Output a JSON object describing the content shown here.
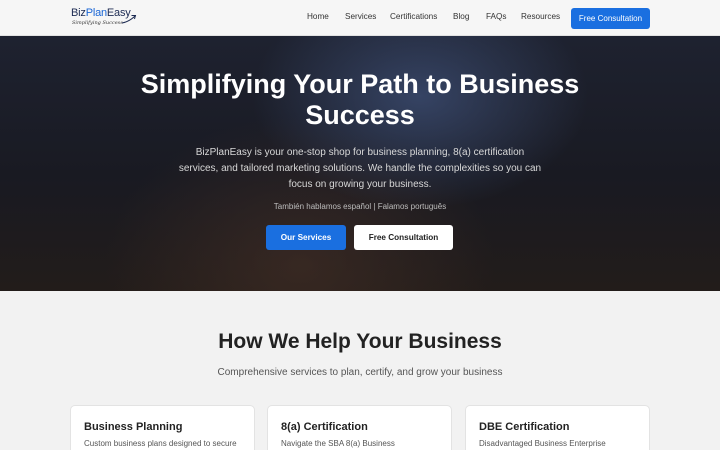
{
  "nav": {
    "logo_biz": "Biz",
    "logo_plan": "Plan",
    "logo_easy": "Easy",
    "logo_tagline": "Simplifying Success",
    "links": [
      "Home",
      "Services",
      "Certifications",
      "Blog",
      "FAQs",
      "Resources"
    ],
    "cta_label": "Free Consultation"
  },
  "hero": {
    "title": "Simplifying Your Path to Business Success",
    "subtitle": "BizPlanEasy is your one-stop shop for business planning, 8(a) certification services, and tailored marketing solutions. We handle the complexities so you can focus on growing your business.",
    "languages": "También hablamos español | Falamos português",
    "primary_button": "Our Services",
    "secondary_button": "Free Consultation"
  },
  "services": {
    "title": "How We Help Your Business",
    "subtitle": "Comprehensive services to plan, certify, and grow your business",
    "cards": [
      {
        "title": "Business Planning",
        "desc": "Custom business plans designed to secure"
      },
      {
        "title": "8(a) Certification",
        "desc": "Navigate the SBA 8(a) Business"
      },
      {
        "title": "DBE Certification",
        "desc": "Disadvantaged Business Enterprise"
      }
    ]
  },
  "colors": {
    "accent": "#1a6fe0",
    "hero_dark": "#1e2230",
    "page_bg": "#f2f2f2"
  }
}
